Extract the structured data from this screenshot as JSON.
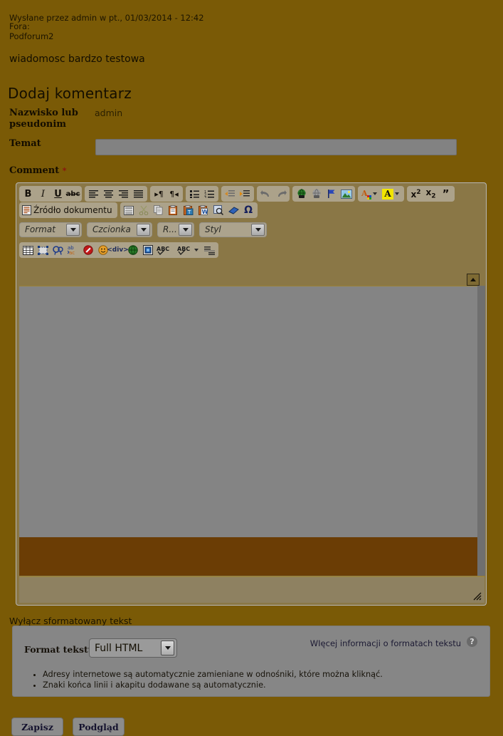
{
  "post": {
    "submitted": "Wysłane przez admin w pt., 01/03/2014 - 12:42",
    "fora_label": "Fora:",
    "forum_link": "Podforum2",
    "body": "wiadomosc bardzo testowa"
  },
  "form": {
    "heading": "Dodaj komentarz",
    "name_label": "Nazwisko lub pseudonim",
    "name_value": "admin",
    "subject_label": "Temat",
    "subject_value": "",
    "comment_label": "Comment",
    "required_marker": "*"
  },
  "editor": {
    "row1": [
      {
        "name": "bold-icon",
        "label": "B"
      },
      {
        "name": "italic-icon",
        "label": "I"
      },
      {
        "name": "underline-icon",
        "label": "U"
      },
      {
        "name": "strikethrough-icon",
        "label": "abc"
      },
      {
        "name": "align-left-icon",
        "label": ""
      },
      {
        "name": "align-center-icon",
        "label": ""
      },
      {
        "name": "align-right-icon",
        "label": ""
      },
      {
        "name": "align-justify-icon",
        "label": ""
      },
      {
        "name": "text-direction-ltr-icon",
        "label": ""
      },
      {
        "name": "text-direction-rtl-icon",
        "label": ""
      },
      {
        "name": "bulleted-list-icon",
        "label": ""
      },
      {
        "name": "numbered-list-icon",
        "label": ""
      },
      {
        "name": "outdent-icon",
        "label": ""
      },
      {
        "name": "indent-icon",
        "label": ""
      },
      {
        "name": "undo-icon",
        "label": ""
      },
      {
        "name": "redo-icon",
        "label": ""
      },
      {
        "name": "link-icon",
        "label": ""
      },
      {
        "name": "unlink-icon",
        "label": ""
      },
      {
        "name": "anchor-icon",
        "label": ""
      },
      {
        "name": "image-icon",
        "label": ""
      },
      {
        "name": "text-color-icon",
        "label": "A"
      },
      {
        "name": "background-color-icon",
        "label": "A"
      },
      {
        "name": "superscript-icon",
        "label": "x2"
      },
      {
        "name": "subscript-icon",
        "label": "x2"
      },
      {
        "name": "blockquote-icon",
        "label": "”"
      }
    ],
    "source_button_label": "Źródło dokumentu",
    "row2": [
      {
        "name": "document-source-icon",
        "label": ""
      },
      {
        "name": "templates-icon",
        "label": ""
      },
      {
        "name": "cut-icon",
        "label": ""
      },
      {
        "name": "copy-icon",
        "label": ""
      },
      {
        "name": "paste-icon",
        "label": ""
      },
      {
        "name": "paste-as-plain-text-icon",
        "label": ""
      },
      {
        "name": "paste-from-word-icon",
        "label": ""
      },
      {
        "name": "find-preview-icon",
        "label": ""
      },
      {
        "name": "remove-format-icon",
        "label": ""
      },
      {
        "name": "special-character-icon",
        "label": "Ω"
      }
    ],
    "combos": [
      {
        "name": "format-combo",
        "label": "Format"
      },
      {
        "name": "font-combo",
        "label": "Czcionka"
      },
      {
        "name": "font-size-combo",
        "label": "R..."
      },
      {
        "name": "styles-combo",
        "label": "Styl"
      }
    ],
    "row4": [
      {
        "name": "table-icon",
        "label": ""
      },
      {
        "name": "show-blocks-icon",
        "label": ""
      },
      {
        "name": "find-icon",
        "label": ""
      },
      {
        "name": "replace-icon",
        "label": ""
      },
      {
        "name": "forbidden-icon",
        "label": ""
      },
      {
        "name": "smiley-icon",
        "label": ""
      },
      {
        "name": "div-container-icon",
        "label": "div"
      },
      {
        "name": "iframe-icon",
        "label": ""
      },
      {
        "name": "flash-icon",
        "label": ""
      },
      {
        "name": "spellcheck-icon",
        "label": "ABC"
      },
      {
        "name": "spellcheck-options-icon",
        "label": "ABC"
      },
      {
        "name": "page-break-icon",
        "label": ""
      }
    ],
    "content": ""
  },
  "filter": {
    "toggle_link": "Wyłącz sformatowany tekst",
    "format_label": "Format tekstu",
    "format_value": "Full HTML",
    "more_info_link": "WIęcej informacji o formatach tekstu",
    "help_glyph": "?",
    "tips": [
      "Adresy internetowe są automatycznie zamieniane w odnośniki, które można kliknąć.",
      "Znaki końca linii i akapitu dodawane są automatycznie."
    ]
  },
  "actions": {
    "save_label": "Zapisz",
    "preview_label": "Podgląd"
  },
  "colors": {
    "page_background": "#7a5a06",
    "input_gray": "#828282",
    "editor_body": "#848484",
    "brown_block": "#6b3d05",
    "required_red": "#8c1111"
  }
}
